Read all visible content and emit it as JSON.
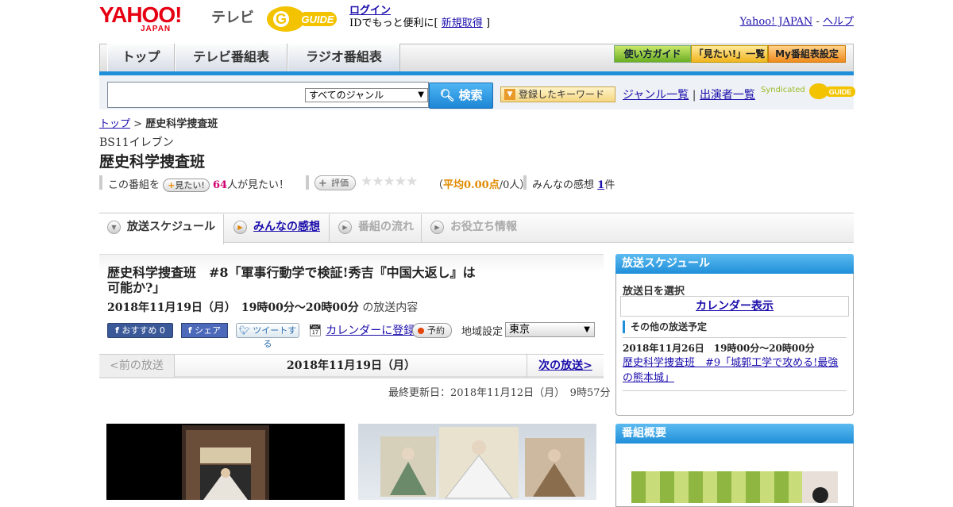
{
  "header": {
    "yahoo_logo": "YAHOO!",
    "yahoo_logo_sub": "JAPAN",
    "tv_label": "テレビ",
    "gguide_logo": "G-GUIDE",
    "login_link": "ログイン",
    "login_text": "IDでもっと便利に[",
    "register_link": "新規取得",
    "login_text_end": "]",
    "yahoo_japan_link": "Yahoo! JAPAN",
    "separator": "-",
    "help_link": "ヘルプ"
  },
  "nav": {
    "tabs": [
      {
        "label": "トップ"
      },
      {
        "label": "テレビ番組表"
      },
      {
        "label": "ラジオ番組表"
      }
    ],
    "guide_btn": "使い方ガイド",
    "mitai_btn": "「見たい!」一覧",
    "mytable_btn": "My番組表設定"
  },
  "search": {
    "placeholder": "",
    "genre_selected": "すべてのジャンル",
    "button": "検索",
    "keyword_btn": "登録したキーワード",
    "genre_link": "ジャンル一覧",
    "divider": "|",
    "cast_link": "出演者一覧",
    "syndicated": "Syndicated"
  },
  "breadcrumb": {
    "top": "トップ",
    "sep": ">",
    "current": "歴史科学捜査班"
  },
  "program": {
    "channel": "BS11イレブン",
    "title": "歴史科学捜査班"
  },
  "stats": {
    "prefix": "この番組を",
    "mitai_btn": "見たい!",
    "count": "64",
    "suffix": "人が見たい！",
    "rate_btn": "評価",
    "stars": "★★★★★",
    "avg_open": "（",
    "avg_label": "平均",
    "avg_score": "0.00点",
    "avg_rest": "/0人）",
    "impressions_label": "みんなの感想",
    "impressions_count": "1",
    "impressions_unit": "件"
  },
  "tabs": [
    {
      "label": "放送スケジュール"
    },
    {
      "label": "みんなの感想"
    },
    {
      "label": "番組の流れ"
    },
    {
      "label": "お役立ち情報"
    }
  ],
  "episode": {
    "title": "歴史科学捜査班　#8「軍事行動学で検証!秀吉『中国大返し』は可能か?」",
    "date_time": "2018年11月19日（月）　19時00分～20時00分",
    "date_suffix": "の放送内容",
    "fb_recommend": "おすすめ 0",
    "fb_share": "シェア",
    "tweet": "ツイートする",
    "calendar_reg": "カレンダーに登録",
    "reserve": "予約",
    "region_label": "地域設定",
    "region_value": "東京"
  },
  "datenav": {
    "prev": "<前の放送",
    "current": "2018年11月19日（月）",
    "next": "次の放送>"
  },
  "updated": "最終更新日：2018年11月12日（月）　9時57分",
  "side": {
    "schedule_head": "放送スケジュール",
    "select_date": "放送日を選択",
    "calendar_btn": "カレンダー表示",
    "other_label": "その他の放送予定",
    "other_time": "2018年11月26日　19時00分～20時00分",
    "other_title": "歴史科学捜査班　#9「城郭工学で攻める!最強の熊本城」",
    "summary_head": "番組概要"
  },
  "colors": {
    "accent_blue": "#1f8fd9",
    "link": "#1a0dab",
    "yahoo_red": "#e60012",
    "count_pink": "#d0006f"
  }
}
